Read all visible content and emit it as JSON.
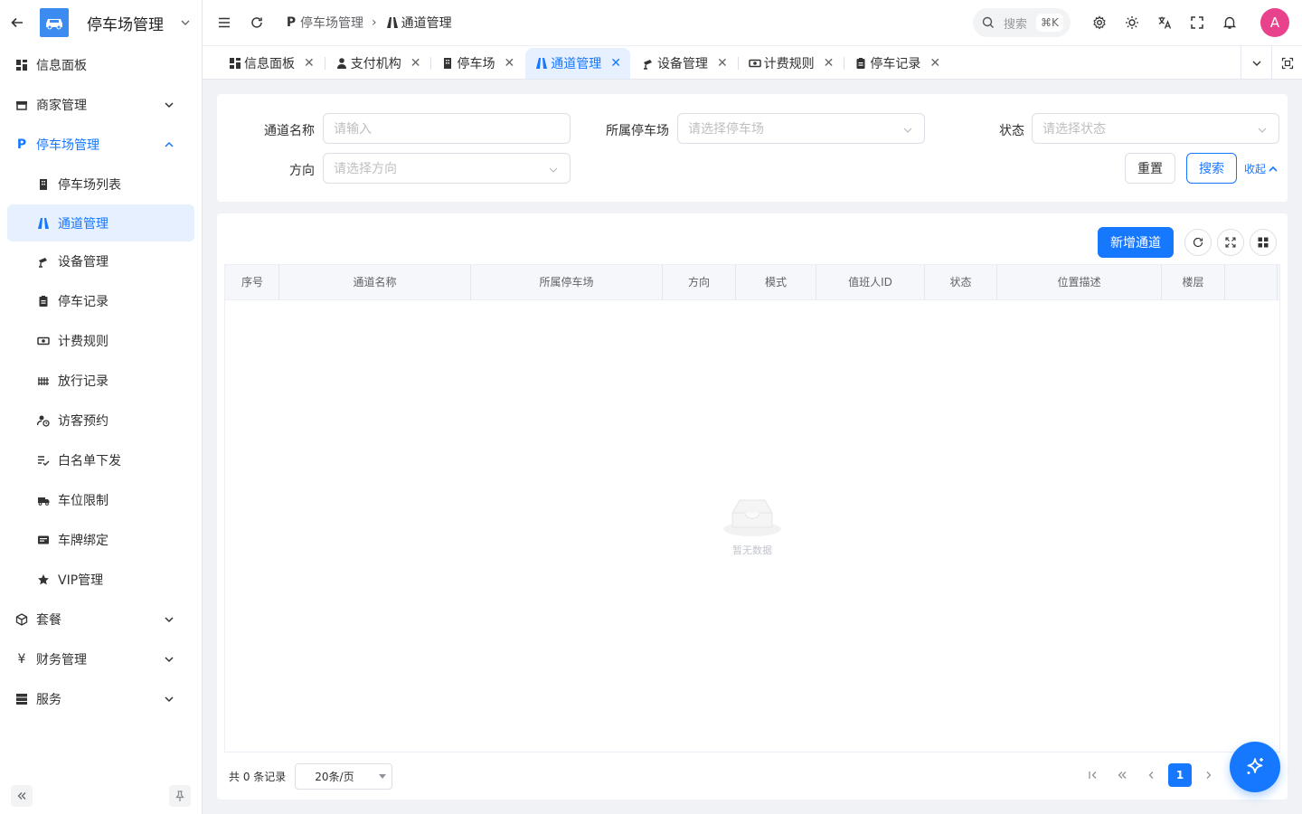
{
  "sidebar": {
    "title": "停车场管理",
    "items": [
      {
        "label": "信息面板"
      },
      {
        "label": "商家管理"
      },
      {
        "label": "停车场管理"
      },
      {
        "label": "停车场列表"
      },
      {
        "label": "通道管理"
      },
      {
        "label": "设备管理"
      },
      {
        "label": "停车记录"
      },
      {
        "label": "计费规则"
      },
      {
        "label": "放行记录"
      },
      {
        "label": "访客预约"
      },
      {
        "label": "白名单下发"
      },
      {
        "label": "车位限制"
      },
      {
        "label": "车牌绑定"
      },
      {
        "label": "VIP管理"
      },
      {
        "label": "套餐"
      },
      {
        "label": "财务管理"
      },
      {
        "label": "服务"
      }
    ]
  },
  "topbar": {
    "breadcrumb": [
      "停车场管理",
      "通道管理"
    ],
    "search_label": "搜索",
    "search_shortcut": "⌘K",
    "avatar_letter": "A"
  },
  "tabs": [
    {
      "label": "信息面板"
    },
    {
      "label": "支付机构"
    },
    {
      "label": "停车场"
    },
    {
      "label": "通道管理"
    },
    {
      "label": "设备管理"
    },
    {
      "label": "计费规则"
    },
    {
      "label": "停车记录"
    }
  ],
  "filter": {
    "channel_name_label": "通道名称",
    "channel_name_placeholder": "请输入",
    "parking_label": "所属停车场",
    "parking_placeholder": "请选择停车场",
    "status_label": "状态",
    "status_placeholder": "请选择状态",
    "direction_label": "方向",
    "direction_placeholder": "请选择方向",
    "reset_label": "重置",
    "search_label": "搜索",
    "collapse_label": "收起"
  },
  "table": {
    "add_label": "新增通道",
    "columns": [
      "序号",
      "通道名称",
      "所属停车场",
      "方向",
      "模式",
      "值班人ID",
      "状态",
      "位置描述",
      "楼层"
    ],
    "empty_text": "暂无数据",
    "total_text": "共 0 条记录",
    "page_size": "20条/页",
    "current_page": "1"
  },
  "colors": {
    "primary": "#1677ff",
    "avatar": "#e8428d",
    "logo": "#3b8bf0"
  }
}
